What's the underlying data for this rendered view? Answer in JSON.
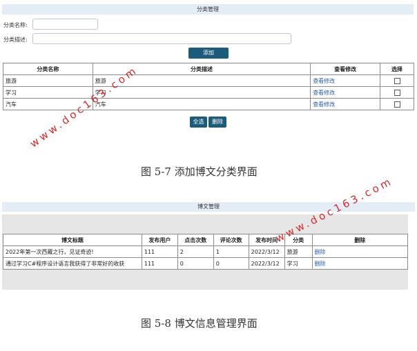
{
  "category_panel": {
    "title": "分类管理",
    "name_label": "分类名称:",
    "desc_label": "分类描述:",
    "name_value": "",
    "desc_value": "",
    "add_button": "添加",
    "columns": [
      "分类名称",
      "分类描述",
      "查看修改",
      "选择"
    ],
    "rows": [
      {
        "name": "旅游",
        "desc": "旅游",
        "action": "查看修改",
        "selected": false
      },
      {
        "name": "学习",
        "desc": "学习",
        "action": "查看修改",
        "selected": false
      },
      {
        "name": "汽车",
        "desc": "汽车",
        "action": "查看修改",
        "selected": false
      }
    ],
    "select_all_button": "全选",
    "delete_button": "删除"
  },
  "caption1": "图 5-7 添加博文分类界面",
  "blog_panel": {
    "title": "博文管理",
    "columns": [
      "博文标题",
      "发布用户",
      "点击次数",
      "评论次数",
      "发布时间",
      "分类",
      "删除"
    ],
    "rows": [
      {
        "title": "2022年第一次西藏之行，见证奇迹!",
        "user": "111",
        "clicks": "2",
        "comments": "1",
        "date": "2022/3/12",
        "category": "旅游",
        "delete": "删除"
      },
      {
        "title": "通过学习C#程序设计语言我获得了非常好的收获",
        "user": "111",
        "clicks": "0",
        "comments": "0",
        "date": "2022/3/12",
        "category": "学习",
        "delete": "删除"
      }
    ]
  },
  "caption2": "图 5-8 博文信息管理界面",
  "watermark": "www.doc163.com",
  "colors": {
    "header_bg": "#e4ecf6",
    "button_bg": "#1d5b7a",
    "link": "#2a5db0",
    "watermark": "#d62b2b",
    "gray_area": "#e6e6e6"
  }
}
